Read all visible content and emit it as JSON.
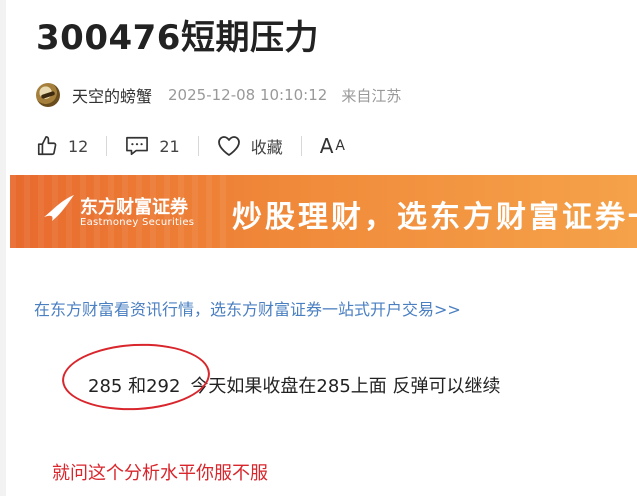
{
  "post": {
    "title": "300476短期压力",
    "author": "天空的螃蟹",
    "datetime": "2025-12-08 10:10:12",
    "source": "来自江苏"
  },
  "actions": {
    "likes": "12",
    "comments": "21",
    "favorite_label": "收藏",
    "font_a_big": "A",
    "font_a_small": "A"
  },
  "banner": {
    "brand_cn": "东方财富证券",
    "brand_en": "Eastmoney Securities",
    "slogan": "炒股理财，选东方财富证券一"
  },
  "promo_link": "在东方财富看资讯行情，选东方财富证券一站式开户交易>>",
  "body": {
    "levels": "285 和292",
    "text": "今天如果收盘在285上面 反弹可以继续",
    "red_note": "就问这个分析水平你服不服"
  },
  "colors": {
    "link": "#4a7fc1",
    "annotation_red": "#d8262c",
    "banner_orange": "#e86a2e"
  }
}
